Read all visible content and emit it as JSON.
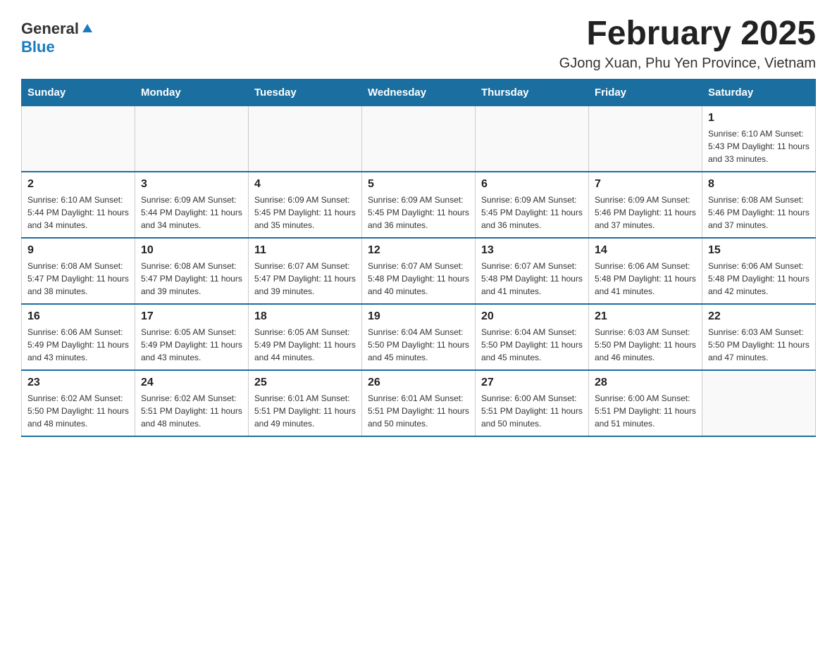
{
  "header": {
    "logo": {
      "general": "General",
      "blue": "Blue",
      "arrow": "▶"
    },
    "title": "February 2025",
    "subtitle": "GJong Xuan, Phu Yen Province, Vietnam"
  },
  "calendar": {
    "days_of_week": [
      "Sunday",
      "Monday",
      "Tuesday",
      "Wednesday",
      "Thursday",
      "Friday",
      "Saturday"
    ],
    "weeks": [
      [
        {
          "day": "",
          "info": ""
        },
        {
          "day": "",
          "info": ""
        },
        {
          "day": "",
          "info": ""
        },
        {
          "day": "",
          "info": ""
        },
        {
          "day": "",
          "info": ""
        },
        {
          "day": "",
          "info": ""
        },
        {
          "day": "1",
          "info": "Sunrise: 6:10 AM\nSunset: 5:43 PM\nDaylight: 11 hours and 33 minutes."
        }
      ],
      [
        {
          "day": "2",
          "info": "Sunrise: 6:10 AM\nSunset: 5:44 PM\nDaylight: 11 hours and 34 minutes."
        },
        {
          "day": "3",
          "info": "Sunrise: 6:09 AM\nSunset: 5:44 PM\nDaylight: 11 hours and 34 minutes."
        },
        {
          "day": "4",
          "info": "Sunrise: 6:09 AM\nSunset: 5:45 PM\nDaylight: 11 hours and 35 minutes."
        },
        {
          "day": "5",
          "info": "Sunrise: 6:09 AM\nSunset: 5:45 PM\nDaylight: 11 hours and 36 minutes."
        },
        {
          "day": "6",
          "info": "Sunrise: 6:09 AM\nSunset: 5:45 PM\nDaylight: 11 hours and 36 minutes."
        },
        {
          "day": "7",
          "info": "Sunrise: 6:09 AM\nSunset: 5:46 PM\nDaylight: 11 hours and 37 minutes."
        },
        {
          "day": "8",
          "info": "Sunrise: 6:08 AM\nSunset: 5:46 PM\nDaylight: 11 hours and 37 minutes."
        }
      ],
      [
        {
          "day": "9",
          "info": "Sunrise: 6:08 AM\nSunset: 5:47 PM\nDaylight: 11 hours and 38 minutes."
        },
        {
          "day": "10",
          "info": "Sunrise: 6:08 AM\nSunset: 5:47 PM\nDaylight: 11 hours and 39 minutes."
        },
        {
          "day": "11",
          "info": "Sunrise: 6:07 AM\nSunset: 5:47 PM\nDaylight: 11 hours and 39 minutes."
        },
        {
          "day": "12",
          "info": "Sunrise: 6:07 AM\nSunset: 5:48 PM\nDaylight: 11 hours and 40 minutes."
        },
        {
          "day": "13",
          "info": "Sunrise: 6:07 AM\nSunset: 5:48 PM\nDaylight: 11 hours and 41 minutes."
        },
        {
          "day": "14",
          "info": "Sunrise: 6:06 AM\nSunset: 5:48 PM\nDaylight: 11 hours and 41 minutes."
        },
        {
          "day": "15",
          "info": "Sunrise: 6:06 AM\nSunset: 5:48 PM\nDaylight: 11 hours and 42 minutes."
        }
      ],
      [
        {
          "day": "16",
          "info": "Sunrise: 6:06 AM\nSunset: 5:49 PM\nDaylight: 11 hours and 43 minutes."
        },
        {
          "day": "17",
          "info": "Sunrise: 6:05 AM\nSunset: 5:49 PM\nDaylight: 11 hours and 43 minutes."
        },
        {
          "day": "18",
          "info": "Sunrise: 6:05 AM\nSunset: 5:49 PM\nDaylight: 11 hours and 44 minutes."
        },
        {
          "day": "19",
          "info": "Sunrise: 6:04 AM\nSunset: 5:50 PM\nDaylight: 11 hours and 45 minutes."
        },
        {
          "day": "20",
          "info": "Sunrise: 6:04 AM\nSunset: 5:50 PM\nDaylight: 11 hours and 45 minutes."
        },
        {
          "day": "21",
          "info": "Sunrise: 6:03 AM\nSunset: 5:50 PM\nDaylight: 11 hours and 46 minutes."
        },
        {
          "day": "22",
          "info": "Sunrise: 6:03 AM\nSunset: 5:50 PM\nDaylight: 11 hours and 47 minutes."
        }
      ],
      [
        {
          "day": "23",
          "info": "Sunrise: 6:02 AM\nSunset: 5:50 PM\nDaylight: 11 hours and 48 minutes."
        },
        {
          "day": "24",
          "info": "Sunrise: 6:02 AM\nSunset: 5:51 PM\nDaylight: 11 hours and 48 minutes."
        },
        {
          "day": "25",
          "info": "Sunrise: 6:01 AM\nSunset: 5:51 PM\nDaylight: 11 hours and 49 minutes."
        },
        {
          "day": "26",
          "info": "Sunrise: 6:01 AM\nSunset: 5:51 PM\nDaylight: 11 hours and 50 minutes."
        },
        {
          "day": "27",
          "info": "Sunrise: 6:00 AM\nSunset: 5:51 PM\nDaylight: 11 hours and 50 minutes."
        },
        {
          "day": "28",
          "info": "Sunrise: 6:00 AM\nSunset: 5:51 PM\nDaylight: 11 hours and 51 minutes."
        },
        {
          "day": "",
          "info": ""
        }
      ]
    ]
  }
}
